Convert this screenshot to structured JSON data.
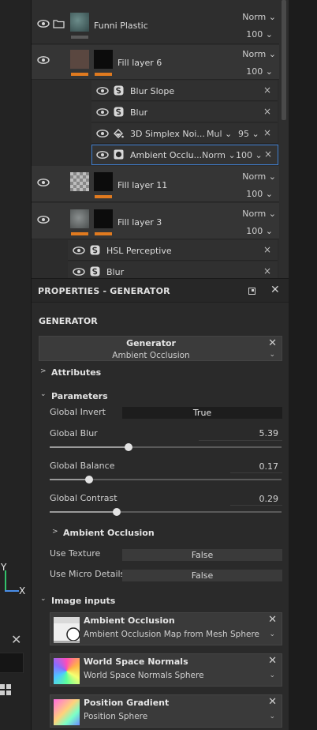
{
  "viewport": {
    "axis_y_label": "Y",
    "axis_x_label": "X",
    "close_glyph": "✕",
    "axis_y_color": "#33c36b",
    "axis_x_color": "#4a8ee8"
  },
  "layers": {
    "accent_color": "#e07a1f",
    "selected_outline_color": "#3f7fd0",
    "folder": {
      "name": "Funni Plastic",
      "blend": "Norm",
      "opacity": "100"
    },
    "fill_layer_6": {
      "name": "Fill layer 6",
      "blend": "Norm",
      "opacity": "100"
    },
    "effects": [
      {
        "name": "Blur Slope",
        "icon": "filter-icon",
        "blend": "",
        "opacity": ""
      },
      {
        "name": "Blur",
        "icon": "filter-icon",
        "blend": "",
        "opacity": ""
      },
      {
        "name": "3D Simplex Noi...",
        "icon": "fill-icon",
        "blend": "Mul",
        "opacity": "95"
      },
      {
        "name": "Ambient Occlu...",
        "icon": "generator-icon",
        "blend": "Norm",
        "opacity": "100"
      }
    ],
    "fill_layer_11": {
      "name": "Fill layer 11",
      "blend": "Norm",
      "opacity": "100"
    },
    "fill_layer_3": {
      "name": "Fill layer 3",
      "blend": "Norm",
      "opacity": "100"
    },
    "effects_3": [
      {
        "name": "HSL Perceptive",
        "icon": "filter-icon"
      },
      {
        "name": "Blur",
        "icon": "filter-icon"
      }
    ],
    "remove_glyph": "×",
    "chevron_glyph": "⌄"
  },
  "properties": {
    "title": "PROPERTIES - GENERATOR",
    "section_title": "GENERATOR",
    "generator": {
      "name": "Generator",
      "value": "Ambient Occlusion"
    },
    "attributes_label": "Attributes",
    "parameters_label": "Parameters",
    "global_invert": {
      "label": "Global Invert",
      "value": "True"
    },
    "global_blur": {
      "label": "Global Blur",
      "value": "5.39",
      "fraction": 0.34
    },
    "global_balance": {
      "label": "Global Balance",
      "value": "0.17",
      "fraction": 0.17
    },
    "global_contrast": {
      "label": "Global Contrast",
      "value": "0.29",
      "fraction": 0.29
    },
    "ao_section_label": "Ambient Occlusion",
    "use_texture": {
      "label": "Use Texture",
      "value": "False"
    },
    "use_micro_details": {
      "label": "Use Micro Details",
      "value": "False"
    },
    "image_inputs_label": "Image inputs",
    "image_inputs": [
      {
        "name": "Ambient Occlusion",
        "source": "Ambient Occlusion Map from Mesh Sphere"
      },
      {
        "name": "World Space Normals",
        "source": "World Space Normals Sphere"
      },
      {
        "name": "Position Gradient",
        "source": "Position Sphere"
      }
    ]
  }
}
